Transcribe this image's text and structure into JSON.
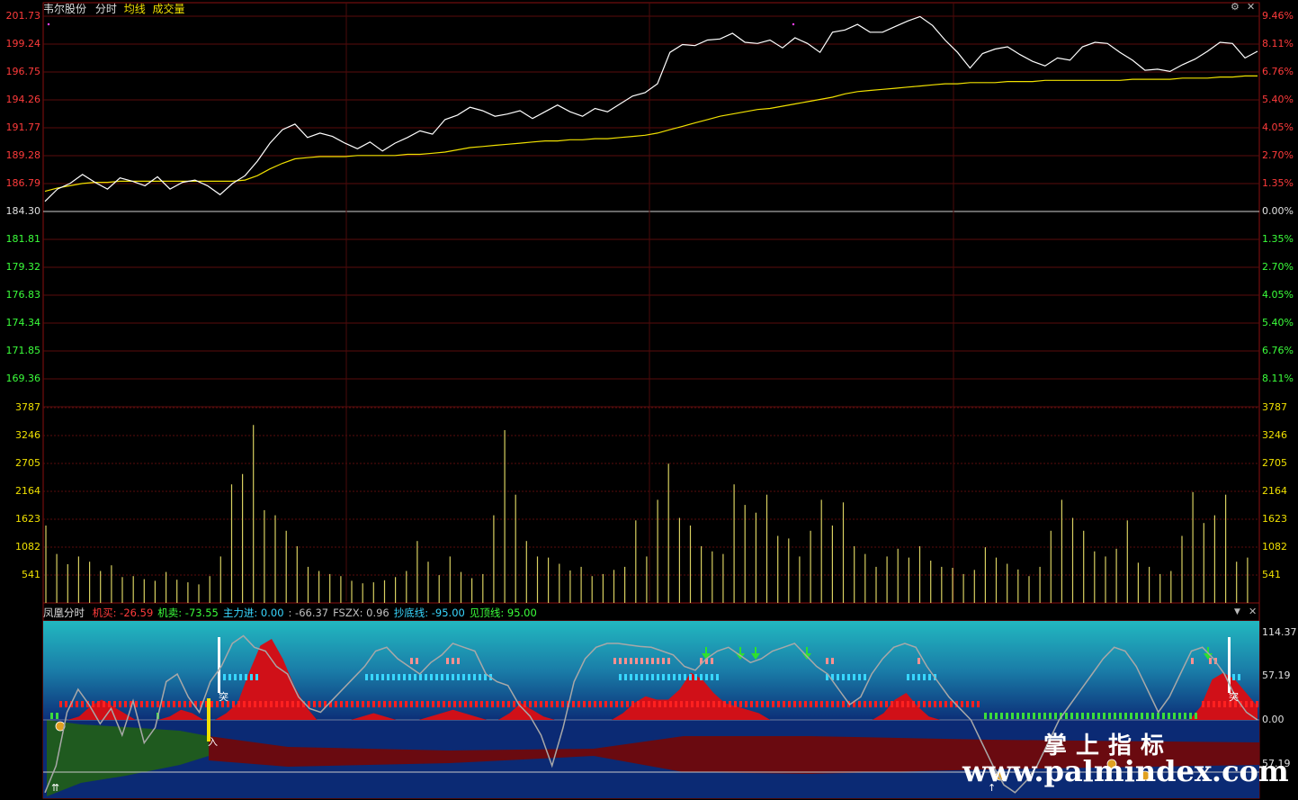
{
  "header": {
    "stock_name": "韦尔股份",
    "mode": "分时",
    "avg_label": "均线",
    "vol_label": "成交量"
  },
  "price_axis": {
    "left_up": [
      "201.73",
      "199.24",
      "196.75",
      "194.26",
      "191.77",
      "189.28",
      "186.79"
    ],
    "left_base": "184.30",
    "left_down": [
      "181.81",
      "179.32",
      "176.83",
      "174.34",
      "171.85",
      "169.36"
    ],
    "right_up": [
      "9.46%",
      "8.11%",
      "6.76%",
      "5.40%",
      "4.05%",
      "2.70%",
      "1.35%"
    ],
    "right_base": "0.00%",
    "right_down": [
      "1.35%",
      "2.70%",
      "4.05%",
      "5.40%",
      "6.76%",
      "8.11%"
    ]
  },
  "volume_axis": [
    "3787",
    "3246",
    "2705",
    "2164",
    "1623",
    "1082",
    "541"
  ],
  "indicator": {
    "name": "凤凰分时",
    "items": [
      {
        "label": "机买:",
        "value": "-26.59",
        "color": "#ff3b3b"
      },
      {
        "label": "机卖:",
        "value": "-73.55",
        "color": "#3bff3b"
      },
      {
        "label": "主力进:",
        "value": "0.00",
        "color": "#38d7ff"
      },
      {
        "label": ":",
        "value": "-66.37",
        "color": "#c0c0c0"
      },
      {
        "label": "FSZX:",
        "value": "0.96",
        "color": "#c0c0c0"
      },
      {
        "label": "抄底线:",
        "value": "-95.00",
        "color": "#38d7ff"
      },
      {
        "label": "见顶线:",
        "value": "95.00",
        "color": "#3bff3b"
      }
    ],
    "axis": [
      "114.37",
      "57.19",
      "0.00",
      "57.19"
    ],
    "markers": {
      "buy": "入",
      "breakout": "突",
      "up_arrow": "↑",
      "double_up": "⇈"
    },
    "dropdown_icon": "▼",
    "close_icon": "✕"
  },
  "window_controls": {
    "settings_icon": "⚙",
    "close_icon": "✕"
  },
  "watermark": {
    "line1": "掌上指标",
    "line2": "www.palmindex.com"
  },
  "colors": {
    "price_line": "#ffffff",
    "avg_line": "#f0e000",
    "volume": "#d8d060",
    "up": "#ff3b3b",
    "down": "#3bff3b",
    "grid": "#8a1010"
  },
  "price_series": [
    185.2,
    186.3,
    186.8,
    187.6,
    186.9,
    186.3,
    187.3,
    187.0,
    186.6,
    187.4,
    186.3,
    186.9,
    187.1,
    186.6,
    185.8,
    186.8,
    187.5,
    188.8,
    190.4,
    191.6,
    192.1,
    190.9,
    191.3,
    191.0,
    190.4,
    189.9,
    190.5,
    189.7,
    190.4,
    190.9,
    191.5,
    191.2,
    192.5,
    192.9,
    193.6,
    193.3,
    192.8,
    193.0,
    193.3,
    192.6,
    193.2,
    193.8,
    193.2,
    192.8,
    193.5,
    193.2,
    193.9,
    194.6,
    194.9,
    195.7,
    198.5,
    199.2,
    199.1,
    199.6,
    199.7,
    200.2,
    199.4,
    199.3,
    199.6,
    198.9,
    199.8,
    199.3,
    198.5,
    200.3,
    200.5,
    201.0,
    200.3,
    200.3,
    200.8,
    201.3,
    201.7,
    200.9,
    199.6,
    198.5,
    197.1,
    198.4,
    198.8,
    199.0,
    198.3,
    197.7,
    197.3,
    198.0,
    197.8,
    199.0,
    199.4,
    199.3,
    198.5,
    197.8,
    196.9,
    197.0,
    196.8,
    197.4,
    197.9,
    198.6,
    199.4,
    199.3,
    198.0,
    198.6
  ],
  "avg_series": [
    186.1,
    186.4,
    186.6,
    186.8,
    186.9,
    186.9,
    187.0,
    187.0,
    187.0,
    187.0,
    187.0,
    187.0,
    187.0,
    187.0,
    187.0,
    187.0,
    187.1,
    187.5,
    188.1,
    188.6,
    189.0,
    189.1,
    189.2,
    189.2,
    189.2,
    189.3,
    189.3,
    189.3,
    189.3,
    189.4,
    189.4,
    189.5,
    189.6,
    189.8,
    190.0,
    190.1,
    190.2,
    190.3,
    190.4,
    190.5,
    190.6,
    190.6,
    190.7,
    190.7,
    190.8,
    190.8,
    190.9,
    191.0,
    191.1,
    191.3,
    191.6,
    191.9,
    192.2,
    192.5,
    192.8,
    193.0,
    193.2,
    193.4,
    193.5,
    193.7,
    193.9,
    194.1,
    194.3,
    194.5,
    194.8,
    195.0,
    195.1,
    195.2,
    195.3,
    195.4,
    195.5,
    195.6,
    195.7,
    195.7,
    195.8,
    195.8,
    195.8,
    195.9,
    195.9,
    195.9,
    196.0,
    196.0,
    196.0,
    196.0,
    196.0,
    196.0,
    196.0,
    196.1,
    196.1,
    196.1,
    196.1,
    196.2,
    196.2,
    196.2,
    196.3,
    196.3,
    196.4,
    196.4
  ],
  "volume_series": [
    1500,
    950,
    750,
    900,
    800,
    620,
    730,
    500,
    520,
    460,
    430,
    600,
    450,
    400,
    360,
    520,
    900,
    2300,
    2500,
    3450,
    1800,
    1700,
    1400,
    1100,
    700,
    620,
    560,
    520,
    430,
    380,
    400,
    440,
    500,
    620,
    1200,
    800,
    540,
    900,
    600,
    480,
    560,
    1700,
    3350,
    2100,
    1200,
    900,
    880,
    760,
    630,
    700,
    520,
    560,
    640,
    700,
    1600,
    900,
    2000,
    2700,
    1650,
    1500,
    1100,
    1000,
    950,
    2300,
    1900,
    1750,
    2100,
    1300,
    1250,
    900,
    1400,
    2000,
    1500,
    1950,
    1100,
    950,
    700,
    900,
    1050,
    880,
    1100,
    820,
    700,
    680,
    560,
    640,
    1080,
    880,
    760,
    650,
    520,
    700,
    1400,
    2000,
    1650,
    1400,
    1000,
    900,
    1050,
    1600,
    780,
    700,
    560,
    620,
    1300,
    2150,
    1550,
    1700,
    2100,
    800,
    880
  ],
  "fsd_series": [
    -95,
    -60,
    10,
    40,
    20,
    -5,
    15,
    -20,
    25,
    -30,
    -10,
    50,
    60,
    30,
    10,
    50,
    70,
    100,
    110,
    95,
    90,
    70,
    60,
    30,
    15,
    10,
    25,
    40,
    55,
    70,
    90,
    95,
    80,
    70,
    60,
    75,
    85,
    100,
    95,
    90,
    60,
    50,
    45,
    20,
    5,
    -20,
    -60,
    -10,
    50,
    80,
    95,
    100,
    100,
    98,
    96,
    95,
    90,
    85,
    70,
    65,
    80,
    90,
    95,
    85,
    75,
    80,
    90,
    95,
    100,
    85,
    70,
    60,
    40,
    20,
    30,
    60,
    80,
    95,
    100,
    95,
    70,
    50,
    30,
    15,
    0,
    -30,
    -60,
    -85,
    -95,
    -80,
    -60,
    -30,
    0,
    20,
    40,
    60,
    80,
    95,
    90,
    70,
    40,
    10,
    30,
    60,
    90,
    95,
    80,
    60,
    30,
    10,
    0
  ],
  "red_area": [
    0,
    0,
    0,
    5,
    20,
    30,
    20,
    10,
    0,
    0,
    0,
    5,
    15,
    10,
    0,
    0,
    10,
    25,
    70,
    110,
    120,
    90,
    50,
    20,
    0,
    0,
    0,
    0,
    5,
    10,
    5,
    0,
    0,
    0,
    5,
    10,
    15,
    10,
    5,
    0,
    0,
    10,
    25,
    15,
    5,
    0,
    0,
    0,
    0,
    0,
    0,
    10,
    25,
    35,
    30,
    30,
    45,
    70,
    60,
    40,
    25,
    20,
    15,
    10,
    0,
    0,
    0,
    0,
    0,
    0,
    0,
    0,
    0,
    0,
    10,
    30,
    40,
    20,
    5,
    0,
    0,
    0,
    0,
    0,
    0,
    0,
    0,
    0,
    0,
    0,
    0,
    0,
    0,
    0,
    0,
    0,
    0,
    0,
    0,
    0,
    0,
    0,
    20,
    60,
    70,
    60,
    40,
    20
  ]
}
